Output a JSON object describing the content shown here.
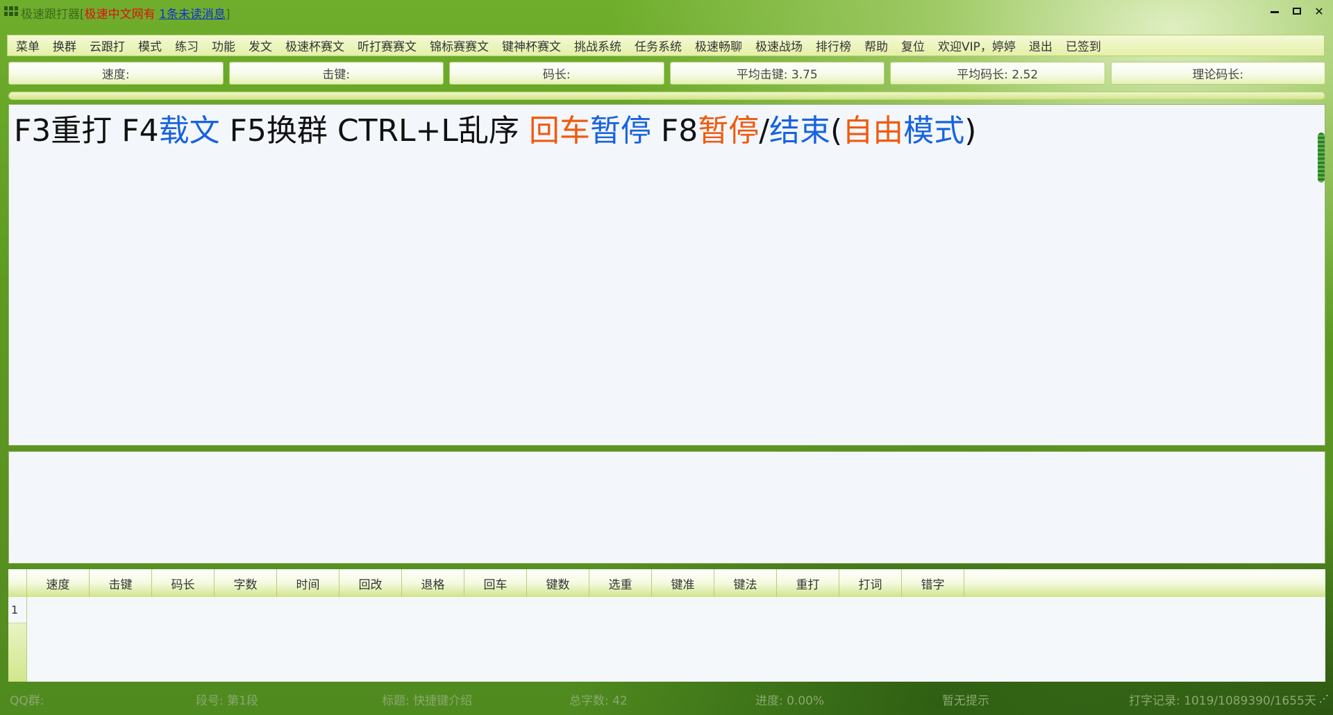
{
  "titlebar": {
    "app_name": "极速跟打器",
    "bracket_open": "[",
    "site_name": "极速中文网有",
    "unread_msg": "1条未读消息",
    "bracket_close": "]",
    "icons": [
      "app-grid-icon",
      "minimize-icon",
      "restore-icon",
      "close-icon"
    ],
    "close_glyph": "✕"
  },
  "menu": {
    "items": [
      "菜单",
      "换群",
      "云跟打",
      "模式",
      "练习",
      "功能",
      "发文",
      "极速杯赛文",
      "听打赛赛文",
      "锦标赛赛文",
      "键神杯赛文",
      "挑战系统",
      "任务系统",
      "极速畅聊",
      "极速战场",
      "排行榜",
      "帮助",
      "复位",
      "欢迎VIP，婷婷",
      "退出",
      "已签到"
    ]
  },
  "stats": {
    "speed": "速度:",
    "keystroke": "击键:",
    "code_length": "码长:",
    "avg_keystroke": "平均击键: 3.75",
    "avg_code_length": "平均码长: 2.52",
    "theory_code_length": "理论码长:"
  },
  "progress": {
    "value": 0
  },
  "text_display": {
    "segments": [
      {
        "text": "F3重打 F4",
        "color": "black"
      },
      {
        "text": "载文",
        "color": "blue"
      },
      {
        "text": " F5换群 CTRL+L乱序 ",
        "color": "black"
      },
      {
        "text": "回车",
        "color": "orange"
      },
      {
        "text": "暂停",
        "color": "blue"
      },
      {
        "text": " F8",
        "color": "black"
      },
      {
        "text": "暂停",
        "color": "orange"
      },
      {
        "text": "/",
        "color": "black"
      },
      {
        "text": "结束",
        "color": "blue"
      },
      {
        "text": "(",
        "color": "black"
      },
      {
        "text": "自由",
        "color": "orange"
      },
      {
        "text": "模式",
        "color": "blue"
      },
      {
        "text": ")",
        "color": "black"
      }
    ]
  },
  "input_area": {
    "value": ""
  },
  "results_table": {
    "columns": [
      "速度",
      "击键",
      "码长",
      "字数",
      "时间",
      "回改",
      "退格",
      "回车",
      "键数",
      "选重",
      "键准",
      "键法",
      "重打",
      "打词",
      "错字"
    ],
    "rows": [
      {
        "index": "1"
      }
    ]
  },
  "statusbar": {
    "qq_group": "QQ群:",
    "segment": "段号: 第1段",
    "title": "标题: 快捷键介绍",
    "char_count": "总字数: 42",
    "progress": "进度: 0.00%",
    "hint": "暂无提示",
    "record": "打字记录: 1019/1089390/1655天"
  },
  "colors": {
    "orange": "#f05a10",
    "blue": "#1862e0",
    "black": "#111111",
    "title_red": "#e01010",
    "link_blue": "#1030d0"
  }
}
